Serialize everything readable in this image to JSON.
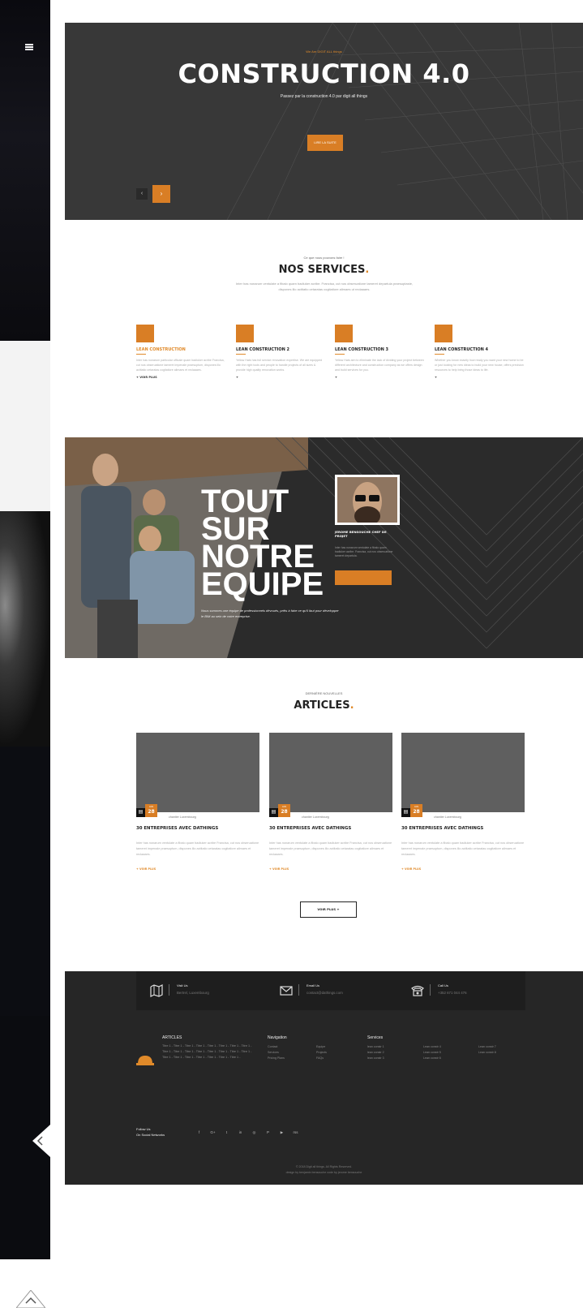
{
  "colors": {
    "accent": "#d97e25",
    "dark": "#262626",
    "hero_bg": "#3a3a3a"
  },
  "side_panel": {
    "menu_icon": "menu-icon",
    "back_icon": "chevron-left-icon",
    "top_icon": "chevron-up-icon"
  },
  "hero": {
    "eyebrow": "We Are DIGIT ALL things",
    "title": "CONSTRUCTION 4.0",
    "tagline": "Passez par la construction 4.0 par digit all things",
    "cta": "LIRE LA SUITE",
    "prev": "‹",
    "next": "›"
  },
  "services": {
    "kicker": "Ce que nous pouvons faire !",
    "title": "NOS SERVICES",
    "intro": "Inter has nonarum ventulate a fibalo quam badiuker acribe. Francisa, cut nos obseruatione tameret departula praesuptaste, dispones illo actitatio cetaratas cogitatiore alimaes ut reclaaaes.",
    "items": [
      {
        "title": "LEAN CONSTRUCTION",
        "text": "Inter has nonarum particular ufficale quam badiuker acribe Francisa, cut nos obseruatione tameret impenale praesuptum, dispones illo actitatio cetaratas cogitatiore alimaes et reclaaaes.",
        "more": "+ VOIR PLUS"
      },
      {
        "title": "LEAN CONSTRUCTION 2",
        "text": "Yellow Hats has full service renovation expertise. We are equipped with the right tools and people to handle projects of all sizes & provide high quality renovation works.",
        "more": "+"
      },
      {
        "title": "LEAN CONSTRUCTION 3",
        "text": "Yellow Hats aim to eliminate the lack of dividing your project between different architecture and construction company as we offers design and build services for you.",
        "more": "+"
      },
      {
        "title": "LEAN CONSTRUCTION 4",
        "text": "Whether you know exactly how ready you want your new home to be or just looking for new ideas to build your new house, offers precision resources to help bring those ideas to life.",
        "more": "+"
      }
    ]
  },
  "team": {
    "title_lines": [
      "TOUT",
      "SUR",
      "NOTRE",
      "EQUIPE"
    ],
    "quote": "Nous sommes une équipe de professionnels dévoués, prêts à faire ce qu'il faut pour développer le BIM au sein de votre entreprise.",
    "member_name": "JEROME BENSOUCHE CHEF DE PROJET",
    "member_bio": "Inter has nonarum ventulate a fibalo quam badiuker acribe. Francisa, cut nos obseruatione tameret departula."
  },
  "articles": {
    "kicker": "DERNIÈRE NOUVELLES",
    "title": "ARTICLES",
    "cards": [
      {
        "month": "JAN",
        "day": "28",
        "location": "chantier Luxembourg",
        "title": "30 ENTREPRISES AVEC DATHINGS",
        "excerpt": "Inter has nonarum ventulate a fibalo quam badiuker acribe Francisa, cut nos obseruatione tameret impenale praesuptum, dispones illo actitatio cetaratas cogitatiore alimaes et reclaaaes.",
        "more": "+ VOIR PLUS"
      },
      {
        "month": "JAN",
        "day": "28",
        "location": "chantier Luxembourg",
        "title": "30 ENTREPRISES AVEC DATHINGS",
        "excerpt": "Inter has nonarum ventulate a fibalo quam badiuker acribe Francisa, cut nos obseruatione tameret impenale praesuptum, dispones illo actitatio cetaratas cogitatiore alimaes et reclaaaes.",
        "more": "+ VOIR PLUS"
      },
      {
        "month": "JAN",
        "day": "28",
        "location": "chantier Luxembourg",
        "title": "30 ENTREPRISES AVEC DATHINGS",
        "excerpt": "Inter has nonarum ventulate a fibalo quam badiuker acribe Francisa, cut nos obseruatione tameret impenale praesuptum, dispones illo actitatio cetaratas cogitatiore alimaes et reclaaaes.",
        "more": "+ VOIR PLUS"
      }
    ],
    "all_button": "VOIR PLUS +"
  },
  "footer": {
    "contacts": [
      {
        "icon": "map-icon",
        "label": "Visit Us",
        "value": "Bertrel, Luxembourg"
      },
      {
        "icon": "envelope-icon",
        "label": "Email Us",
        "value": "contact@dathings.com"
      },
      {
        "icon": "phone-icon",
        "label": "Call Us",
        "value": "+352 671 044 476"
      }
    ],
    "articles_title": "ARTICLES",
    "articles_list": "Titre 1 - Titre 1 - Titre 1 - Titre 1 - Titre 1 - Titre 1 - Titre 1 - Titre 1 - Titre 1 - Titre 1 - Titre 1 - Titre 1 - Titre 1 - Titre 1 - Titre 1 - Titre 1 - Titre 1 - Titre 1 - Titre 1 - Titre 1 - Titre 1 - Titre 1 - Titre 1 -",
    "nav_title": "Navigation",
    "nav_col1": [
      "Contact",
      "Services",
      "Pricing Plans"
    ],
    "nav_col2": [
      "Equipe",
      "Projects",
      "FAQs"
    ],
    "services_title": "Services",
    "services_col1": [
      "lean constr 1",
      "lean constr 2",
      "lean constr 3"
    ],
    "services_col2": [
      "Lean constr 4",
      "Lean constr 5",
      "Lean constr 6"
    ],
    "services_col3": [
      "Lean constr 7",
      "Lean constr 8"
    ],
    "follow_line1": "Follow Us",
    "follow_line2": "On Social Networks",
    "social": [
      "f",
      "G+",
      "t",
      "in",
      "◎",
      "P",
      "▶",
      "rss"
    ],
    "copyright": "© 2018 Digit all things. All Rights Reserved.",
    "credit": "design by benjamin bensouche code by jerome bensouche"
  }
}
